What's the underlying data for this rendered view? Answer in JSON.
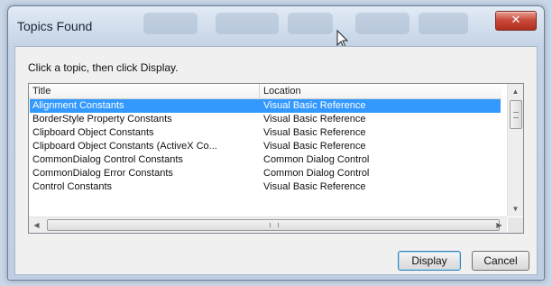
{
  "dialog": {
    "title": "Topics Found",
    "instruction": "Click a topic, then click Display."
  },
  "list": {
    "columns": [
      "Title",
      "Location"
    ],
    "rows": [
      {
        "title": "Alignment Constants",
        "location": "Visual Basic Reference",
        "selected": true
      },
      {
        "title": "BorderStyle Property Constants",
        "location": "Visual Basic Reference"
      },
      {
        "title": "Clipboard Object Constants",
        "location": "Visual Basic Reference"
      },
      {
        "title": "Clipboard Object Constants (ActiveX Co...",
        "location": "Visual Basic Reference"
      },
      {
        "title": "CommonDialog Control Constants",
        "location": "Common Dialog Control"
      },
      {
        "title": "CommonDialog Error Constants",
        "location": "Common Dialog Control"
      },
      {
        "title": "Control Constants",
        "location": "Visual Basic Reference"
      }
    ]
  },
  "buttons": {
    "display": "Display",
    "cancel": "Cancel",
    "close_glyph": "✕"
  },
  "colors": {
    "selection": "#3399ff",
    "close_button": "#c8483a"
  }
}
